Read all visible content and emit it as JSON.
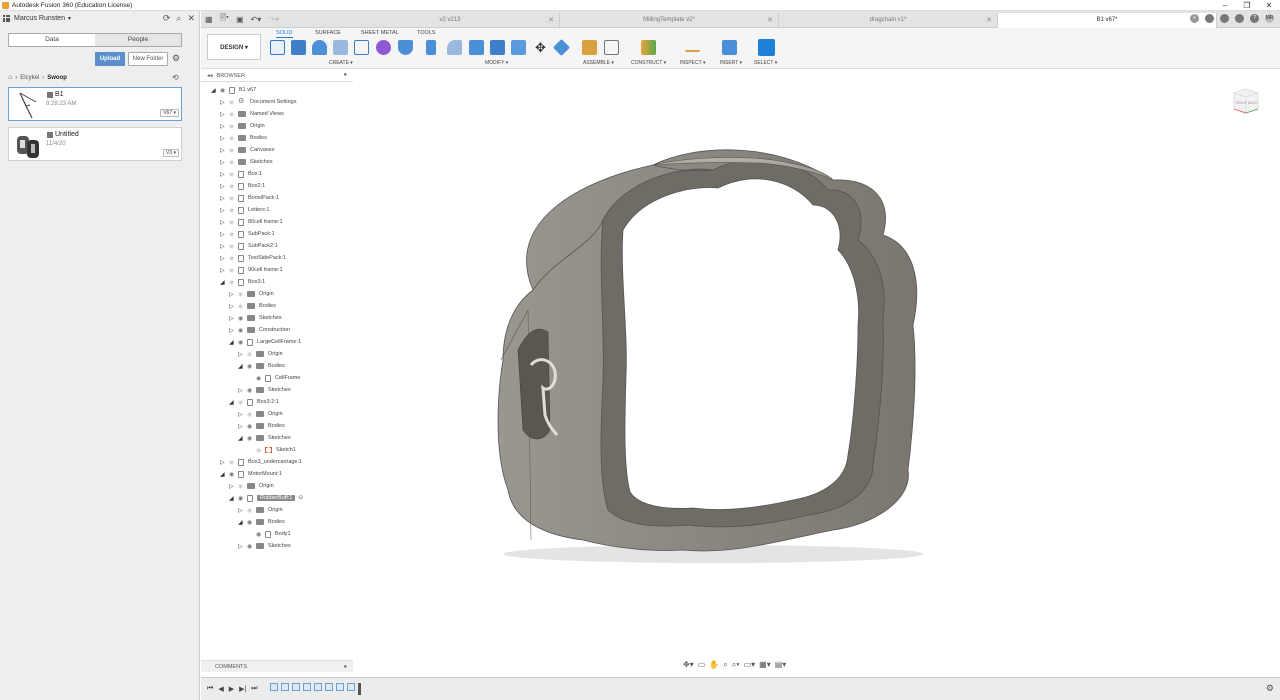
{
  "window": {
    "title": "Autodesk Fusion 360 (Education License)",
    "controls": [
      "–",
      "❐",
      "✕"
    ]
  },
  "left_panel": {
    "user": "Marcus Runsten",
    "seg_tabs": [
      "Data",
      "People"
    ],
    "upload_label": "Upload",
    "new_folder_label": "New Folder",
    "breadcrumb": [
      "Elcykel",
      "Swoop"
    ],
    "files": [
      {
        "name": "B1",
        "date": "8:28:23 AM",
        "version": "V67 ▾"
      },
      {
        "name": "Untitled",
        "date": "11/4/20",
        "version": "V3 ▾"
      }
    ]
  },
  "tabs": [
    {
      "label": "v2 v213",
      "active": false
    },
    {
      "label": "MillingTemplate v2*",
      "active": false
    },
    {
      "label": "dragchain v1*",
      "active": false
    },
    {
      "label": "B1 v67*",
      "active": true
    }
  ],
  "user_initials": "MR",
  "ribbon": {
    "workspace": "DESIGN ▾",
    "tabs": [
      "SOLID",
      "SURFACE",
      "SHEET METAL",
      "TOOLS"
    ],
    "groups": [
      "CREATE ▾",
      "MODIFY ▾",
      "ASSEMBLE ▾",
      "CONSTRUCT ▾",
      "INSPECT ▾",
      "INSERT ▾",
      "SELECT ▾"
    ]
  },
  "browser": {
    "header": "BROWSER",
    "comments_label": "COMMENTS",
    "rows": [
      {
        "label": "B1 v67",
        "indent": 0,
        "tri": "◢",
        "eye": true,
        "icon": "comp"
      },
      {
        "label": "Document Settings",
        "indent": 1,
        "tri": "▷",
        "eye": false,
        "icon": "gear"
      },
      {
        "label": "Named Views",
        "indent": 1,
        "tri": "▷",
        "eye": false,
        "icon": "folder"
      },
      {
        "label": "Origin",
        "indent": 1,
        "tri": "▷",
        "eye": false,
        "icon": "folder"
      },
      {
        "label": "Bodies",
        "indent": 1,
        "tri": "▷",
        "eye": false,
        "icon": "folder"
      },
      {
        "label": "Canvases",
        "indent": 1,
        "tri": "▷",
        "eye": false,
        "icon": "folder"
      },
      {
        "label": "Sketches",
        "indent": 1,
        "tri": "▷",
        "eye": false,
        "icon": "folder"
      },
      {
        "label": "Box:1",
        "indent": 1,
        "tri": "▷",
        "eye": false,
        "icon": "comp"
      },
      {
        "label": "Box2:1",
        "indent": 1,
        "tri": "▷",
        "eye": false,
        "icon": "comp"
      },
      {
        "label": "BoostPack:1",
        "indent": 1,
        "tri": "▷",
        "eye": false,
        "icon": "comp"
      },
      {
        "label": "Letters:1",
        "indent": 1,
        "tri": "▷",
        "eye": false,
        "icon": "comp"
      },
      {
        "label": "80cell frame:1",
        "indent": 1,
        "tri": "▷",
        "eye": false,
        "icon": "comp"
      },
      {
        "label": "SubPack:1",
        "indent": 1,
        "tri": "▷",
        "eye": false,
        "icon": "comp"
      },
      {
        "label": "SubPack2:1",
        "indent": 1,
        "tri": "▷",
        "eye": false,
        "icon": "comp"
      },
      {
        "label": "TestSidePack:1",
        "indent": 1,
        "tri": "▷",
        "eye": false,
        "icon": "comp"
      },
      {
        "label": "90cell frame:1",
        "indent": 1,
        "tri": "▷",
        "eye": false,
        "icon": "comp"
      },
      {
        "label": "Box3:1",
        "indent": 1,
        "tri": "◢",
        "eye": false,
        "icon": "comp"
      },
      {
        "label": "Origin",
        "indent": 2,
        "tri": "▷",
        "eye": false,
        "icon": "folder"
      },
      {
        "label": "Bodies",
        "indent": 2,
        "tri": "▷",
        "eye": false,
        "icon": "folder"
      },
      {
        "label": "Sketches",
        "indent": 2,
        "tri": "▷",
        "eye": true,
        "icon": "folder"
      },
      {
        "label": "Construction",
        "indent": 2,
        "tri": "▷",
        "eye": true,
        "icon": "folder"
      },
      {
        "label": "LargeCellFrame:1",
        "indent": 2,
        "tri": "◢",
        "eye": true,
        "icon": "comp"
      },
      {
        "label": "Origin",
        "indent": 3,
        "tri": "▷",
        "eye": false,
        "icon": "folder"
      },
      {
        "label": "Bodies",
        "indent": 3,
        "tri": "◢",
        "eye": true,
        "icon": "folder"
      },
      {
        "label": "CellFrame",
        "indent": 4,
        "tri": "",
        "eye": true,
        "icon": "comp"
      },
      {
        "label": "Sketches",
        "indent": 3,
        "tri": "▷",
        "eye": true,
        "icon": "folder"
      },
      {
        "label": "Box3:2:1",
        "indent": 2,
        "tri": "◢",
        "eye": false,
        "icon": "comp"
      },
      {
        "label": "Origin",
        "indent": 3,
        "tri": "▷",
        "eye": false,
        "icon": "folder"
      },
      {
        "label": "Bodies",
        "indent": 3,
        "tri": "▷",
        "eye": true,
        "icon": "folder"
      },
      {
        "label": "Sketches",
        "indent": 3,
        "tri": "◢",
        "eye": true,
        "icon": "folder"
      },
      {
        "label": "Sketch1",
        "indent": 4,
        "tri": "",
        "eye": false,
        "icon": "sketch"
      },
      {
        "label": "Box3_undercarriage:1",
        "indent": 1,
        "tri": "▷",
        "eye": false,
        "icon": "comp"
      },
      {
        "label": "MotorMount:1",
        "indent": 1,
        "tri": "◢",
        "eye": true,
        "icon": "comp"
      },
      {
        "label": "Origin",
        "indent": 2,
        "tri": "▷",
        "eye": false,
        "icon": "folder"
      },
      {
        "label": "RubberBuff:1",
        "indent": 2,
        "tri": "◢",
        "eye": true,
        "icon": "comp",
        "highlight": true
      },
      {
        "label": "Origin",
        "indent": 3,
        "tri": "▷",
        "eye": false,
        "icon": "folder"
      },
      {
        "label": "Bodies",
        "indent": 3,
        "tri": "◢",
        "eye": true,
        "icon": "folder"
      },
      {
        "label": "Body1",
        "indent": 4,
        "tri": "",
        "eye": true,
        "icon": "comp"
      },
      {
        "label": "Sketches",
        "indent": 3,
        "tri": "▷",
        "eye": true,
        "icon": "folder"
      }
    ]
  },
  "viewcube": {
    "left_label": "RIGHT",
    "front_label": "BACK"
  },
  "colors": {
    "accent": "#2a7bd5",
    "upload": "#5a8fcc",
    "model": "#8a8680"
  }
}
